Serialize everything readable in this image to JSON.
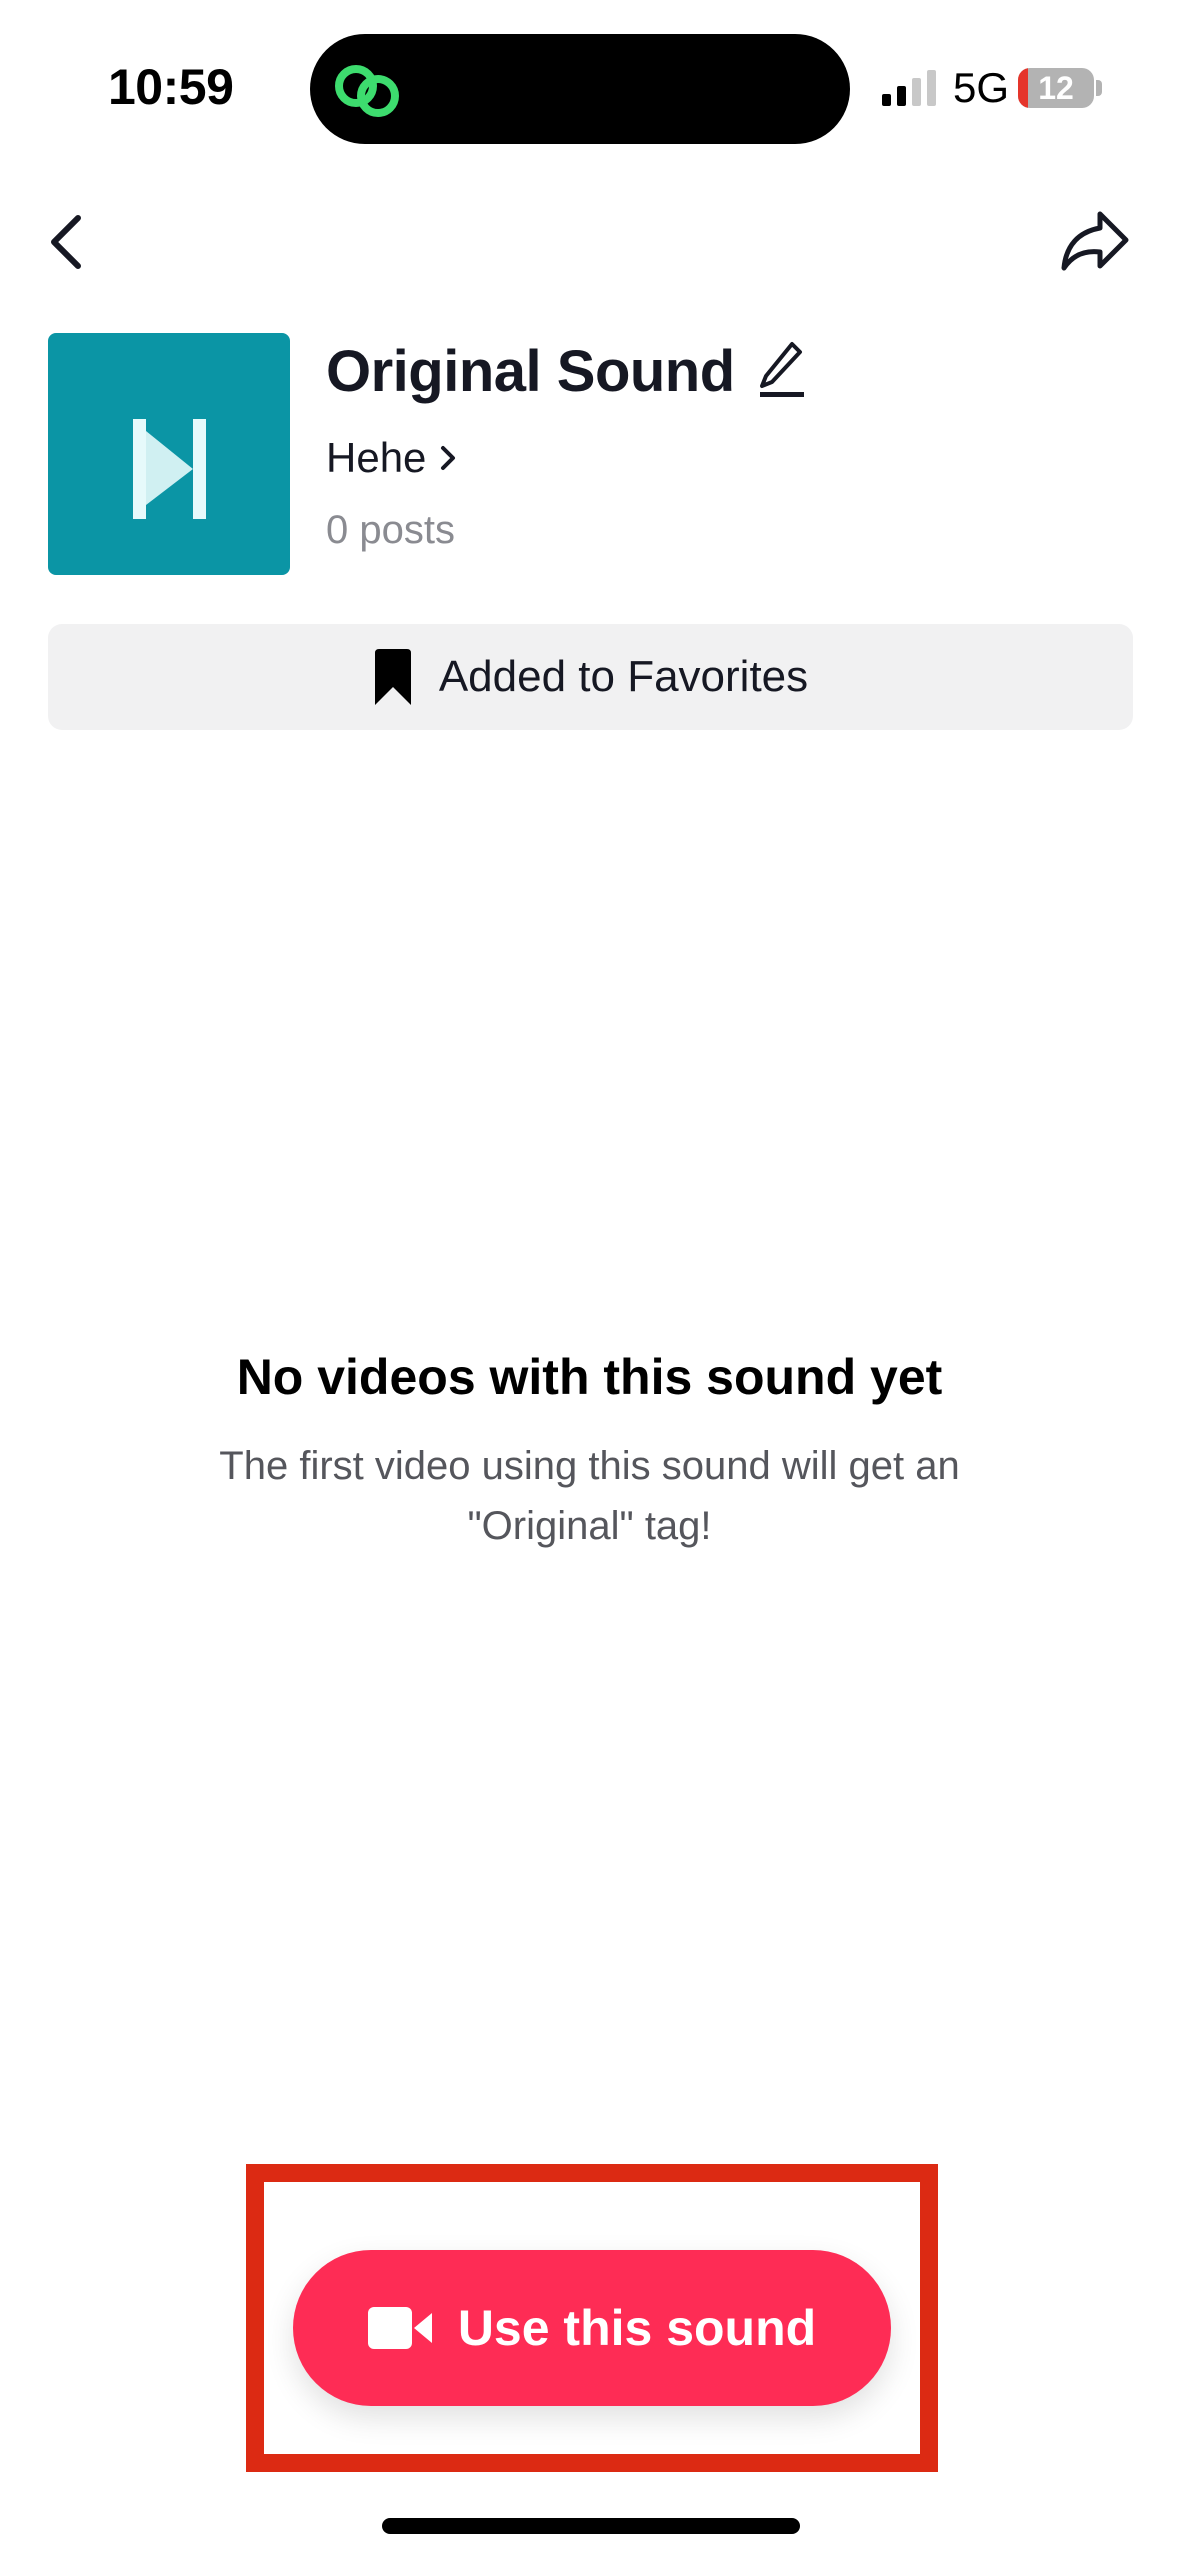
{
  "status_bar": {
    "time": "10:59",
    "network": "5G",
    "battery_percent": "12",
    "signal_bars_active": 2,
    "signal_bars_total": 4,
    "island_icon": "link-rings-icon",
    "island_icon_color": "#3ddc6e"
  },
  "nav": {
    "back_icon": "chevron-left-icon",
    "share_icon": "share-arrow-icon"
  },
  "sound": {
    "title": "Original Sound",
    "author": "Hehe",
    "posts": "0 posts",
    "cover_color": "#0b95a5",
    "edit_icon": "pencil-icon"
  },
  "favorites": {
    "label": "Added to Favorites",
    "icon": "bookmark-filled-icon"
  },
  "empty_state": {
    "title": "No videos with this sound yet",
    "description": "The first video using this sound will get an \"Original\" tag!"
  },
  "cta": {
    "label": "Use this sound",
    "icon": "video-camera-icon",
    "color": "#fe2c55"
  },
  "annotation": {
    "highlight_color": "#dc2a13"
  }
}
